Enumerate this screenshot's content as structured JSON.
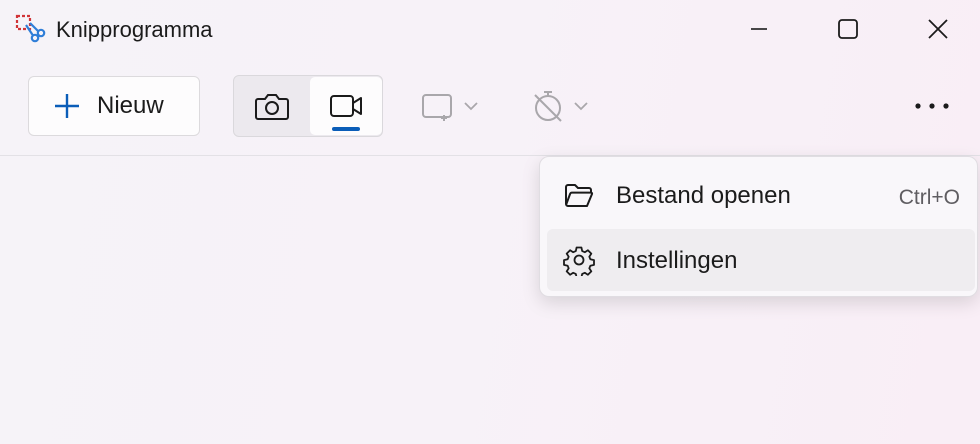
{
  "window": {
    "title": "Knipprogramma",
    "controls": [
      "minimize",
      "maximize",
      "close"
    ]
  },
  "toolbar": {
    "new_label": "Nieuw",
    "mode": {
      "options": [
        "screenshot",
        "video"
      ],
      "selected": "video"
    },
    "shape_icon": "rectangle-snip-icon",
    "timer_icon": "no-timer-icon",
    "more_icon": "more-options-icon"
  },
  "menu": {
    "items": [
      {
        "label": "Bestand openen",
        "shortcut": "Ctrl+O",
        "icon": "folder-open-icon"
      },
      {
        "label": "Instellingen",
        "shortcut": "",
        "icon": "gear-icon"
      }
    ],
    "hovered_index": 1
  },
  "colors": {
    "accent": "#0a5db8",
    "snip_icon_red": "#d13438",
    "snip_icon_blue": "#2f7ed8"
  }
}
